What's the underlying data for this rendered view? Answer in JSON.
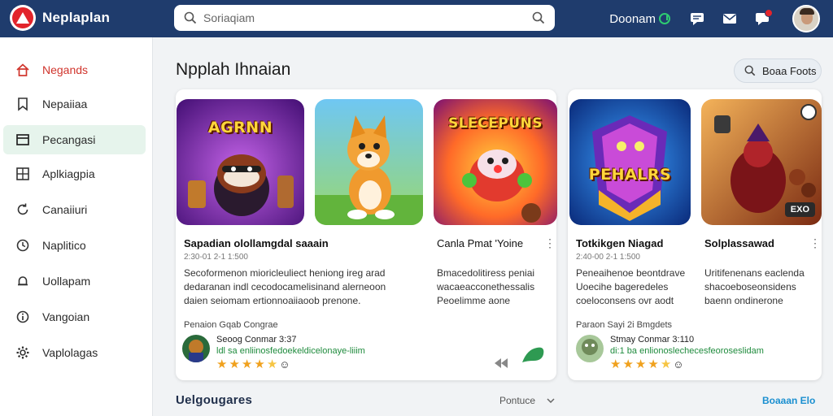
{
  "app": {
    "name": "Neplaplan"
  },
  "search": {
    "placeholder": "Soriaqiam"
  },
  "header": {
    "account_label": "Doonam"
  },
  "sidebar": {
    "items": [
      {
        "label": "Negands",
        "icon": "home-icon",
        "active": false
      },
      {
        "label": "Nepaiiaa",
        "icon": "bookmark-icon",
        "active": false
      },
      {
        "label": "Pecangasi",
        "icon": "window-icon",
        "active": true
      },
      {
        "label": "Aplkiagpia",
        "icon": "grid-icon",
        "active": false
      },
      {
        "label": "Canaiiuri",
        "icon": "refresh-icon",
        "active": false
      },
      {
        "label": "Naplitico",
        "icon": "clock-icon",
        "active": false
      },
      {
        "label": "Uollapam",
        "icon": "bell-icon",
        "active": false
      },
      {
        "label": "Vangoian",
        "icon": "info-icon",
        "active": false
      },
      {
        "label": "Vaplolagas",
        "icon": "settings-icon",
        "active": false
      }
    ]
  },
  "main": {
    "title": "Npplah Ihnaian",
    "filter_button": "Boaa Foots",
    "tiles": [
      {
        "label": "AGRNN",
        "theme": "purple"
      },
      {
        "label": "",
        "theme": "sky"
      },
      {
        "label": "SLECEPUNS",
        "theme": "orange"
      },
      {
        "label": "PEHALRS",
        "theme": "blue"
      },
      {
        "label": "",
        "theme": "red",
        "badge": "EXO"
      }
    ],
    "games": [
      {
        "title": "Sapadian olollamgdal saaain",
        "meta": "2:30-01 2-1 1:500",
        "desc": "Secoformenon mioricleuliect heniong ireg arad dedaranan indl cecodocamelisinand alerneoon daien seiomam ertionnoaiiaoob prenone.",
        "subheader": "Penaion Gqab Congrae"
      },
      {
        "title": "Canla Pmat 'Yoine",
        "meta": "",
        "desc": "Bmacedolitiress peniai wacaeacconethessalis Peoelimme aone"
      },
      {
        "title": "Totkikgen Niagad",
        "meta": "2:40-00 2-1 1:500",
        "desc": "Peneaihenoe beontdrave Uoecihe bageredeles coeloconsens ovr aodt",
        "subheader": "Paraon Sayi 2i Bmgdets"
      },
      {
        "title": "Solplassawad",
        "meta": "",
        "desc": "Uritifenenans eaclenda shacoeboseonsidens baenn ondinerone"
      }
    ],
    "reviews": [
      {
        "name": "Seoog Conmar 3:37",
        "line": "ldl sa enliinosfedoekeldicelonaye-liiim",
        "stars": 4,
        "half": true
      },
      {
        "name": "Stmay Conmar 3:110",
        "line": "di:1 ba enlionoslechecesfeoroseslidam",
        "stars": 4,
        "half": true
      }
    ]
  },
  "bottom": {
    "section_title": "Uelgougares",
    "sort_label": "Pontuce",
    "link": "Boaaan Elo"
  },
  "colors": {
    "topbar": "#1f3c6d",
    "accent_red": "#e2242b",
    "active_bg": "#e6f4ec",
    "link_blue": "#1a8fd0",
    "review_green": "#1f8b3d",
    "star": "#f0a11e"
  }
}
